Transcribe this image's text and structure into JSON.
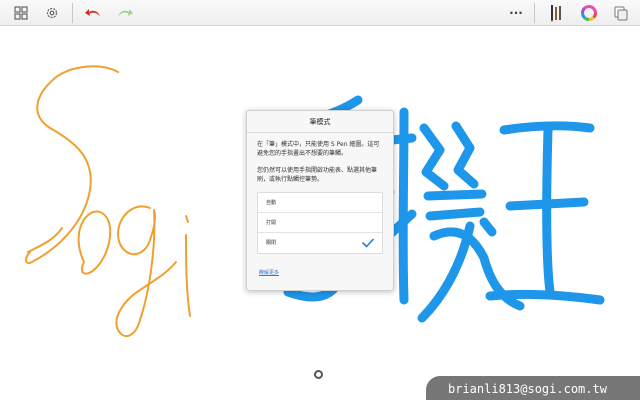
{
  "toolbar": {
    "left_icons": [
      "grid-icon",
      "settings-icon",
      "undo-icon",
      "redo-icon"
    ],
    "right_icons": [
      "more-icon",
      "pen-tools-icon",
      "color-wheel-icon",
      "layers-icon"
    ],
    "more_label": "···"
  },
  "drawing": {
    "orange_text": "Sogi",
    "blue_text": "手機王",
    "orange_color": "#f0a030",
    "blue_color": "#1e96ea"
  },
  "dialog": {
    "title": "筆模式",
    "paragraph1": "在「筆」模式中，只能使用 S Pen 繪圖。這可避免您的手指畫出不想要的筆觸。",
    "paragraph2": "您仍然可以使用手指開啟功能表、點選其他筆刷，或執行點觸控筆勢。",
    "options": [
      {
        "label": "自動",
        "selected": false
      },
      {
        "label": "打開",
        "selected": false
      },
      {
        "label": "關閉",
        "selected": true
      }
    ],
    "learn_more": "瞭解更多"
  },
  "watermark": "brianli813@sogi.com.tw",
  "colors": {
    "accent": "#2c7bd6",
    "check": "#2c7bd6"
  }
}
